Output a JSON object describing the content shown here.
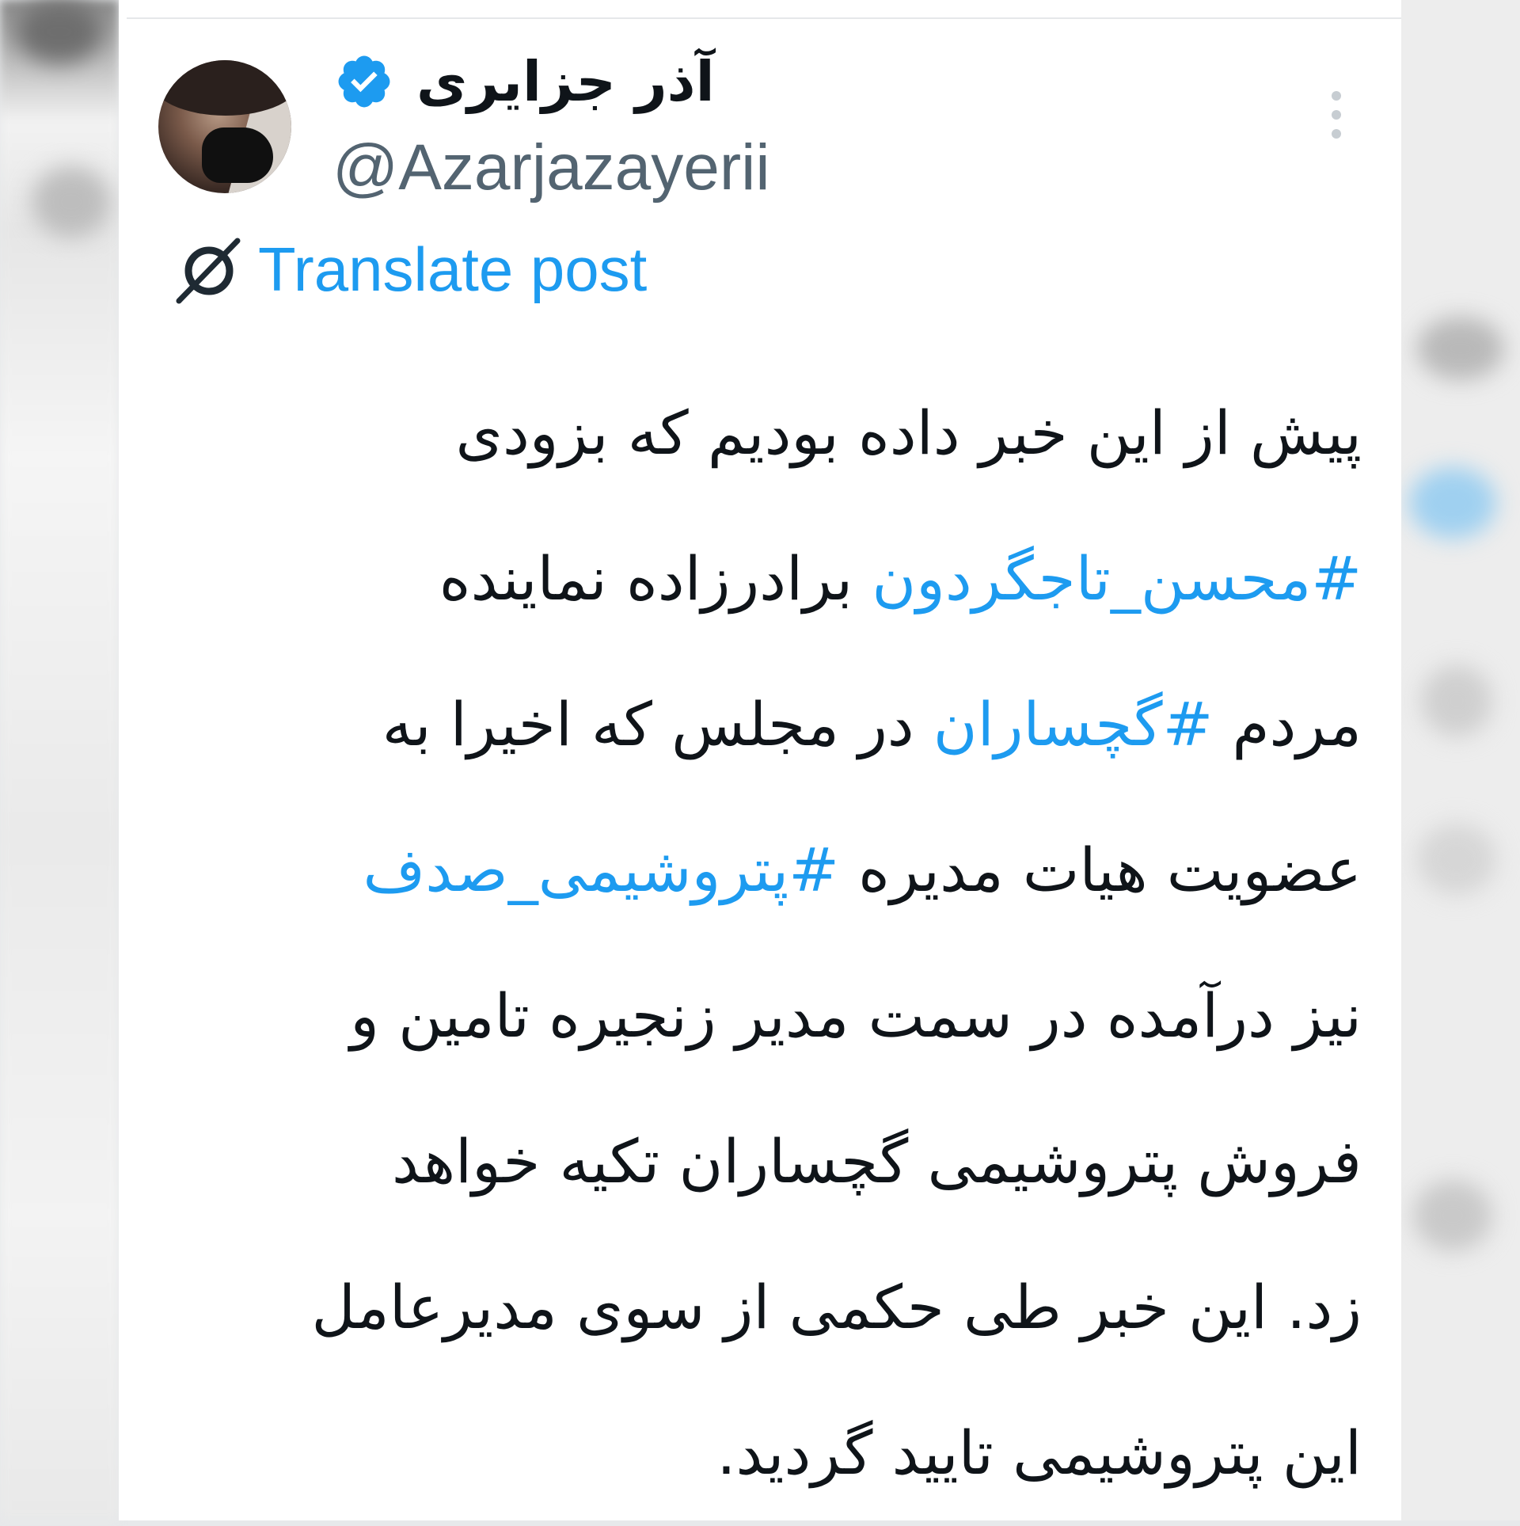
{
  "user": {
    "display_name": "آذر جزایری",
    "handle": "@Azarjazayerii",
    "verified": true
  },
  "translate": {
    "label": "Translate post"
  },
  "tweet": {
    "lines": [
      {
        "text": "پیش از این خبر داده بودیم که بزودی"
      },
      {
        "tag": "#محسن_تاجگردون",
        "text": " برادرزاده نماینده"
      },
      {
        "pre": "مردم ",
        "tag": "#گچساران",
        "text": " در مجلس که اخیرا به"
      },
      {
        "pre": "عضویت هیات مدیره ",
        "tag": "#پتروشیمی_صدف"
      },
      {
        "text": "نیز درآمده در سمت مدیر زنجیره تامین و"
      },
      {
        "text": "فروش پتروشیمی گچساران تکیه خواهد"
      },
      {
        "text": "زد. این خبر طی حکمی از سوی مدیرعامل"
      },
      {
        "text": "این پتروشیمی تایید گردید."
      }
    ]
  },
  "colors": {
    "accent": "#1d9bf0",
    "text": "#0f1419",
    "secondary": "#536471"
  },
  "icons": {
    "verified": "verified-badge-icon",
    "more": "more-options-icon",
    "translate": "translate-icon"
  }
}
